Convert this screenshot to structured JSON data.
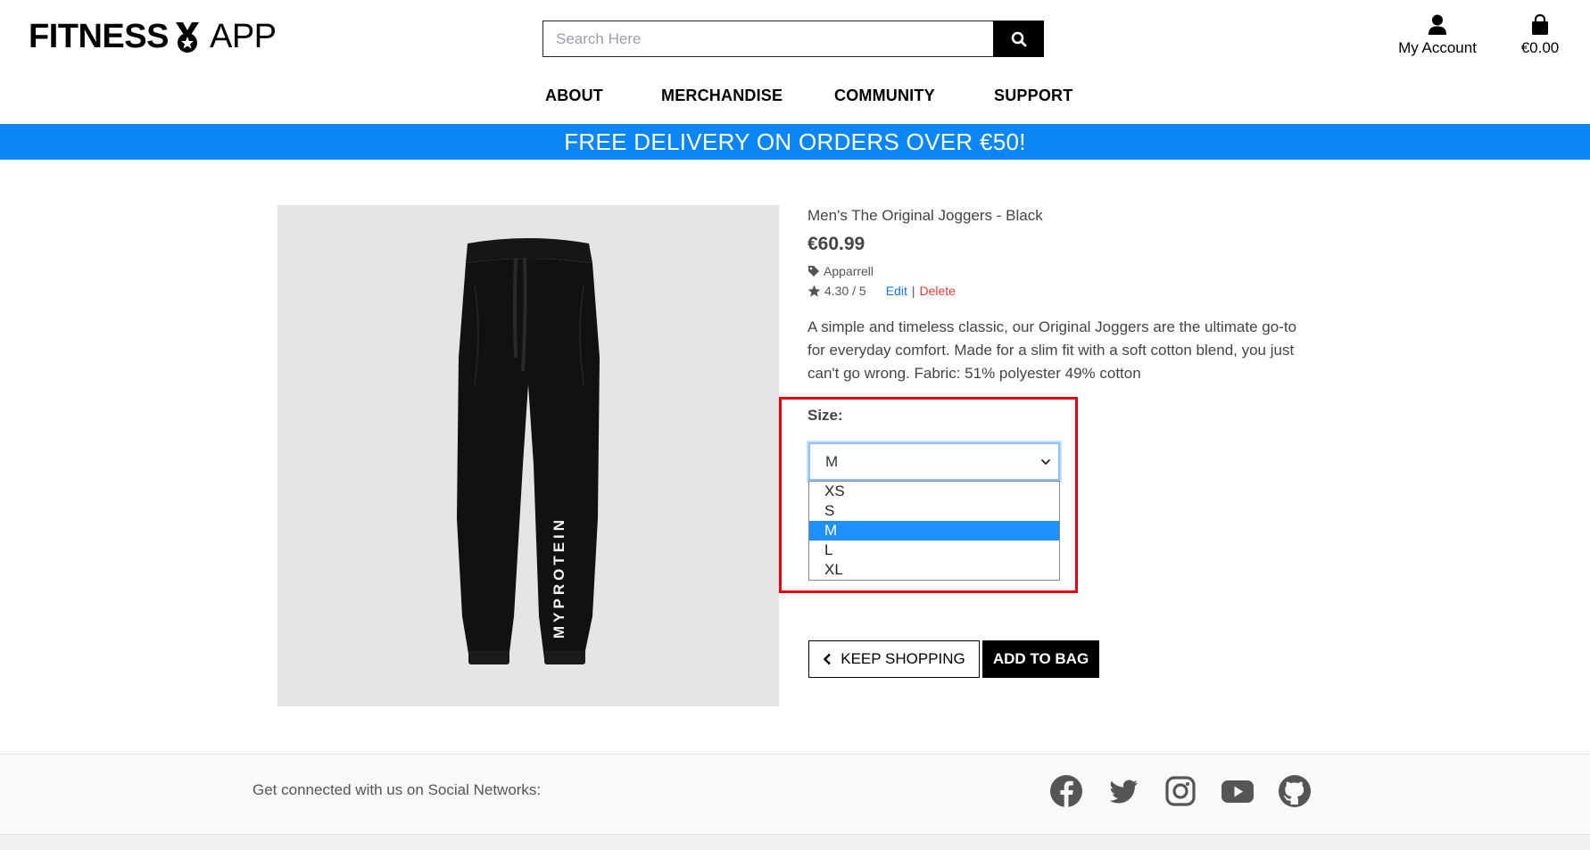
{
  "header": {
    "logo_left": "FITNESS",
    "logo_right": "APP",
    "search_placeholder": "Search Here",
    "account_label": "My Account",
    "bag_total": "€0.00"
  },
  "nav": {
    "items": [
      "ABOUT",
      "MERCHANDISE",
      "COMMUNITY",
      "SUPPORT"
    ]
  },
  "banner": {
    "text": "FREE DELIVERY ON ORDERS OVER €50!"
  },
  "product": {
    "name": "Men's The Original Joggers - Black",
    "price": "€60.99",
    "category": "Apparrell",
    "rating": "4.30 / 5",
    "edit_label": "Edit",
    "separator": "|",
    "delete_label": "Delete",
    "description": "A simple and timeless classic, our Original Joggers are the ultimate go-to for everyday comfort. Made for a slim fit with a soft cotton blend, you just can't go wrong. Fabric: 51% polyester 49% cotton",
    "image_brand_text": "MYPROTEIN"
  },
  "size": {
    "label": "Size:",
    "selected": "M",
    "options": [
      "XS",
      "S",
      "M",
      "L",
      "XL"
    ]
  },
  "actions": {
    "keep_shopping": "KEEP SHOPPING",
    "add_to_bag": "ADD TO BAG"
  },
  "footer": {
    "social_text": "Get connected with us on Social Networks:",
    "icons": [
      "facebook-icon",
      "twitter-icon",
      "instagram-icon",
      "youtube-icon",
      "github-icon"
    ]
  },
  "colors": {
    "banner": "#0c86f5",
    "highlight": "#e8000e",
    "selected_option": "#1e90ff",
    "edit_link": "#1a73e8",
    "delete_link": "#e53935"
  }
}
